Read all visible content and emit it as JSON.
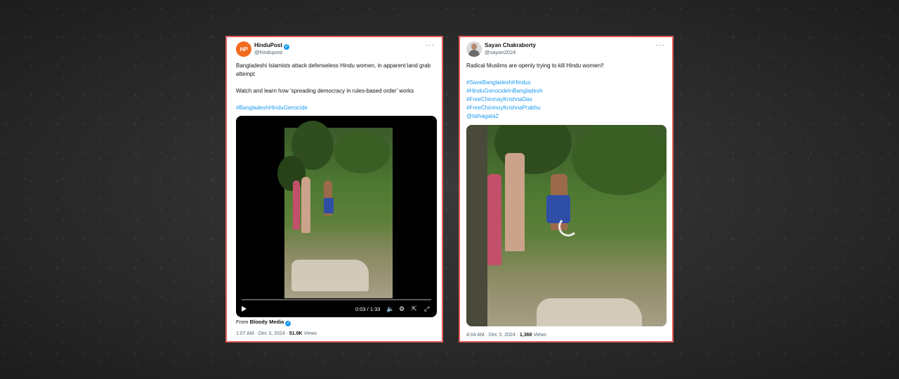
{
  "left_post": {
    "avatar_text": "HP",
    "name": "HinduPost",
    "handle": "@hindupost",
    "more": "···",
    "line1": "Bangladeshi Islamists attack defenseless Hindu women, in apparent land grab attempt",
    "line2": "Watch and learn how 'spreading democracy in rules-based order' works",
    "hashtag": "#BangladeshHinduGenocide",
    "video": {
      "time": "0:03 / 1:33"
    },
    "from_prefix": "From",
    "from_source": "Bloody Media",
    "time": "1:07 AM · Dec 3, 2024 · ",
    "views_count": "51.9K",
    "views_label": " Views"
  },
  "right_post": {
    "name": "Sayan Chakraborty",
    "handle": "@sayan2024",
    "more": "···",
    "line1": "Radical Muslims are openly trying to kill Hindu women!!",
    "tags": [
      "#SaveBangladeshiHindus",
      "#HinduGenocideInBangladesh",
      "#FreeChinmayKrishnaDas",
      "#FreeChinmoyKrishnaPrabhu",
      "@tathagata2"
    ],
    "time": "4:04 AM · Dec 3, 2024 · ",
    "views_count": "1,368",
    "views_label": " Views"
  },
  "colors": {
    "accent": "#1d9bf0",
    "frame": "#e35b5b",
    "brand": "#f26b1d"
  },
  "icons": [
    "verified-badge-icon",
    "more-icon",
    "play-icon",
    "volume-icon",
    "settings-icon",
    "share-icon",
    "fullscreen-icon",
    "loading-spinner-icon"
  ]
}
